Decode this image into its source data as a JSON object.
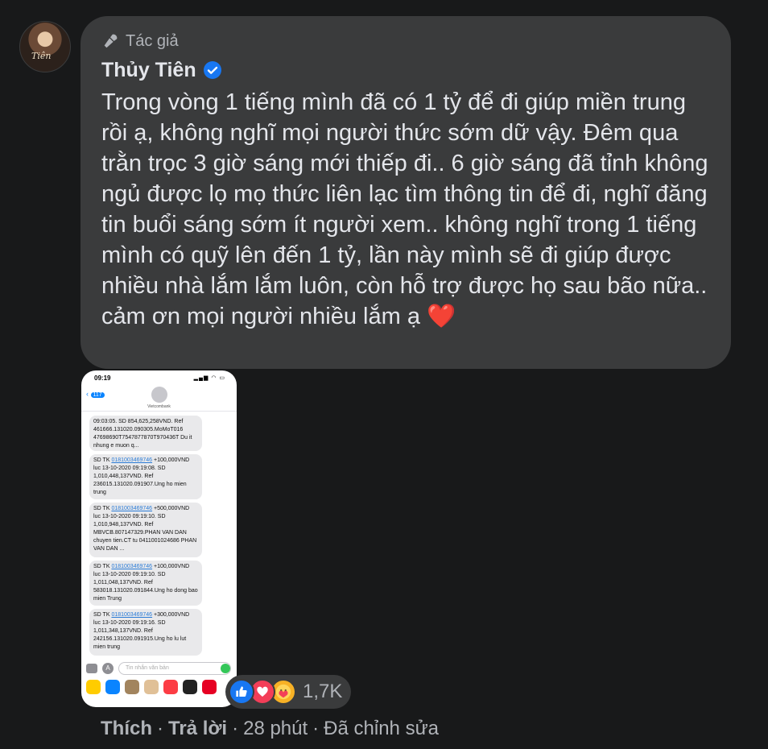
{
  "comment": {
    "author_tag": "Tác giả",
    "author_name": "Thủy Tiên",
    "avatar_signature": "Tiên",
    "text": "Trong vòng 1 tiếng mình đã có 1 tỷ để đi giúp miền trung rồi ạ, không nghĩ mọi người thức sớm dữ vậy. Đêm qua trằn trọc 3 giờ sáng mới thiếp đi.. 6 giờ sáng đã tỉnh không ngủ được lọ mọ thức liên lạc tìm thông tin để đi, nghĩ đăng tin buổi sáng sớm ít người xem.. không nghĩ trong 1 tiếng mình có quỹ lên đến 1 tỷ, lần này mình sẽ đi giúp được nhiều nhà lắm lắm luôn, còn hỗ trợ được họ sau bão nữa.. cảm ơn mọi người nhiều lắm ạ",
    "emoji": "❤️"
  },
  "screenshot": {
    "time": "09:19",
    "back_count": "117",
    "contact": "Vietcombank",
    "messages": [
      {
        "pre": "",
        "link": "",
        "post": "09:03:05. SD 854,625,258VND. Ref 461666.131020.090305.MoMoT016 47698690T7547877870T970436T Du it nhung e muon q..."
      },
      {
        "pre": "SD TK ",
        "link": "0181003469746",
        "post": " +100,000VND luc 13-10-2020 09:19:08. SD 1,010,448,137VND. Ref 236015.131020.091907.Ung ho mien trung"
      },
      {
        "pre": "SD TK ",
        "link": "0181003469746",
        "post": " +500,000VND luc 13-10-2020 09:19:10. SD 1,010,948,137VND. Ref MBVCB.807147329.PHAN VAN DAN chuyen tien.CT tu 0411001024686 PHAN VAN DAN ..."
      },
      {
        "pre": "SD TK ",
        "link": "0181003469746",
        "post": " +100,000VND luc 13-10-2020 09:19:10. SD 1,011,048,137VND. Ref 583018.131020.091844.Ung ho dong bao mien Trung"
      },
      {
        "pre": "SD TK ",
        "link": "0181003469746",
        "post": " +300,000VND luc 13-10-2020 09:19:16. SD 1,011,348,137VND. Ref 242156.131020.091915.Ung ho lu lut mien trung"
      }
    ],
    "input_placeholder": "Tin nhắn văn bản"
  },
  "reactions": {
    "count": "1,7K",
    "types": [
      "like-icon",
      "love-icon",
      "care-icon"
    ]
  },
  "actions": {
    "like": "Thích",
    "reply": "Trả lời",
    "time": "28 phút",
    "edited": "Đã chỉnh sửa",
    "sep": "·"
  },
  "colors": {
    "background": "#18191a",
    "bubble": "#3a3b3c",
    "text": "#e4e6eb",
    "secondary": "#b0b3b8",
    "like_blue": "#1877f2",
    "love_red": "#f33e58"
  }
}
